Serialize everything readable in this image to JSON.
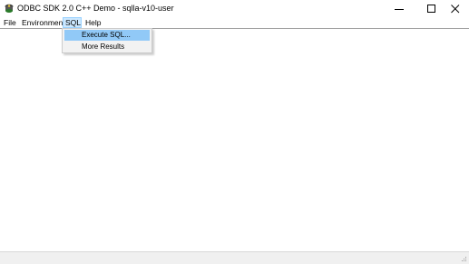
{
  "window": {
    "title": "ODBC SDK 2.0 C++ Demo - sqlla-v10-user",
    "app_icon": "odbc-app-icon",
    "controls": {
      "minimize_icon": "minimize-icon",
      "maximize_icon": "maximize-icon",
      "close_icon": "close-icon"
    }
  },
  "menubar": {
    "items": [
      {
        "label": "File"
      },
      {
        "label": "Environment"
      },
      {
        "label": "SQL",
        "state": "open"
      },
      {
        "label": "Help"
      }
    ]
  },
  "sql_menu": {
    "items": [
      {
        "label": "Execute SQL...",
        "highlighted": true
      },
      {
        "label": "More Results",
        "highlighted": false
      }
    ]
  },
  "colors": {
    "menu_open_bg": "#cce8ff",
    "menu_highlight_bg": "#91c9f7",
    "dropdown_bg": "#f2f2f2",
    "statusbar_bg": "#f0f0f0"
  }
}
